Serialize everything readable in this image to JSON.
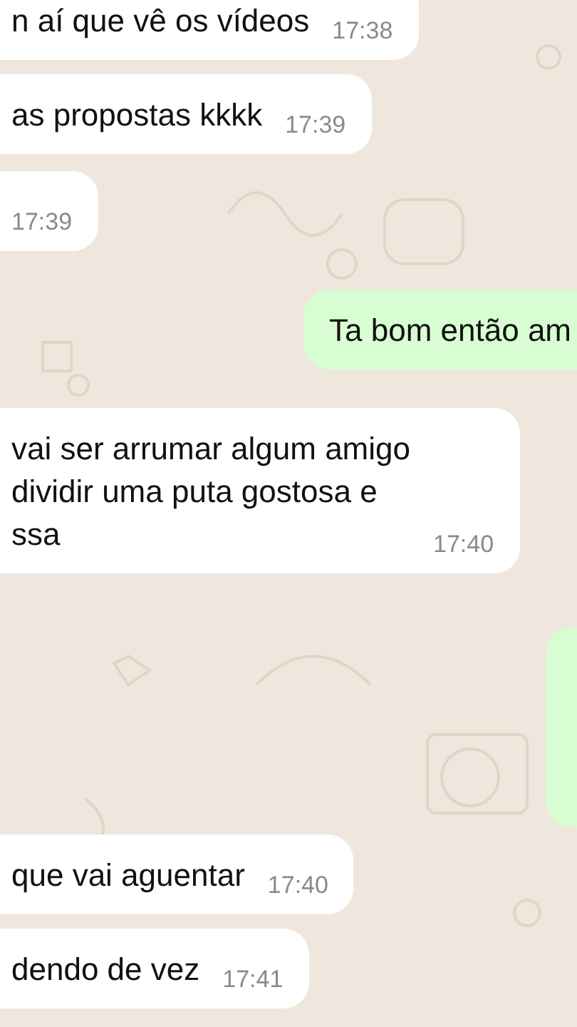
{
  "messages": [
    {
      "kind": "incoming",
      "lines": [
        "n aí que vê os vídeos"
      ],
      "time": "17:38"
    },
    {
      "kind": "incoming",
      "lines": [
        "as propostas kkkk"
      ],
      "time": "17:39"
    },
    {
      "kind": "incoming",
      "time": "17:39"
    },
    {
      "kind": "outgoing",
      "lines": [
        "Ta bom então am"
      ]
    },
    {
      "kind": "incoming",
      "lines": [
        "vai ser arrumar algum amigo",
        "dividir uma puta gostosa e",
        "ssa"
      ],
      "time": "17:40"
    },
    {
      "kind": "outgoing"
    },
    {
      "kind": "incoming",
      "lines": [
        "que vai aguentar"
      ],
      "time": "17:40"
    },
    {
      "kind": "incoming",
      "lines": [
        "dendo de vez"
      ],
      "time": "17:41"
    }
  ]
}
